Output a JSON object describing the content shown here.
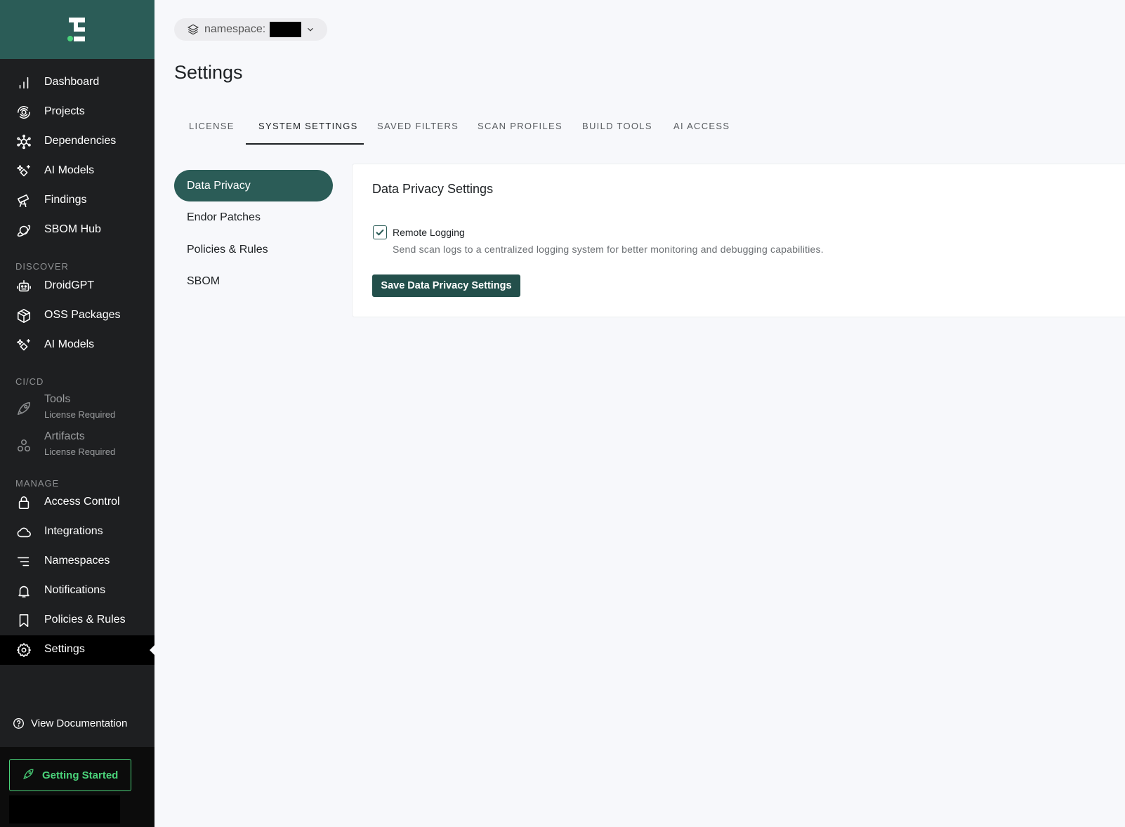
{
  "namespace": {
    "label": "namespace:"
  },
  "page": {
    "title": "Settings"
  },
  "sidebar": {
    "items": [
      {
        "label": "Dashboard"
      },
      {
        "label": "Projects"
      },
      {
        "label": "Dependencies"
      },
      {
        "label": "AI Models"
      },
      {
        "label": "Findings"
      },
      {
        "label": "SBOM Hub"
      }
    ],
    "discover": {
      "title": "DISCOVER",
      "items": [
        {
          "label": "DroidGPT"
        },
        {
          "label": "OSS Packages"
        },
        {
          "label": "AI Models"
        }
      ]
    },
    "cicd": {
      "title": "CI/CD",
      "items": [
        {
          "label": "Tools",
          "sub": "License Required"
        },
        {
          "label": "Artifacts",
          "sub": "License Required"
        }
      ]
    },
    "manage": {
      "title": "MANAGE",
      "items": [
        {
          "label": "Access Control"
        },
        {
          "label": "Integrations"
        },
        {
          "label": "Namespaces"
        },
        {
          "label": "Notifications"
        },
        {
          "label": "Policies & Rules"
        },
        {
          "label": "Settings"
        }
      ]
    },
    "docs_label": "View Documentation",
    "getting_started_label": "Getting Started"
  },
  "tabs": [
    {
      "label": "LICENSE"
    },
    {
      "label": "SYSTEM SETTINGS"
    },
    {
      "label": "SAVED FILTERS"
    },
    {
      "label": "SCAN PROFILES"
    },
    {
      "label": "BUILD TOOLS"
    },
    {
      "label": "AI ACCESS"
    }
  ],
  "active_tab": "SYSTEM SETTINGS",
  "subnav": [
    {
      "label": "Data Privacy"
    },
    {
      "label": "Endor Patches"
    },
    {
      "label": "Policies & Rules"
    },
    {
      "label": "SBOM"
    }
  ],
  "card": {
    "title": "Data Privacy Settings",
    "option_label": "Remote Logging",
    "option_checked": true,
    "option_desc": "Send scan logs to a centralized logging system for better monitoring and debugging capabilities.",
    "save_label": "Save Data Privacy Settings"
  },
  "colors": {
    "brand": "#2b5c57",
    "sidebar_bg": "#1e1f21",
    "accent_green": "#4ad37a",
    "page_bg": "#f7f8fb"
  }
}
